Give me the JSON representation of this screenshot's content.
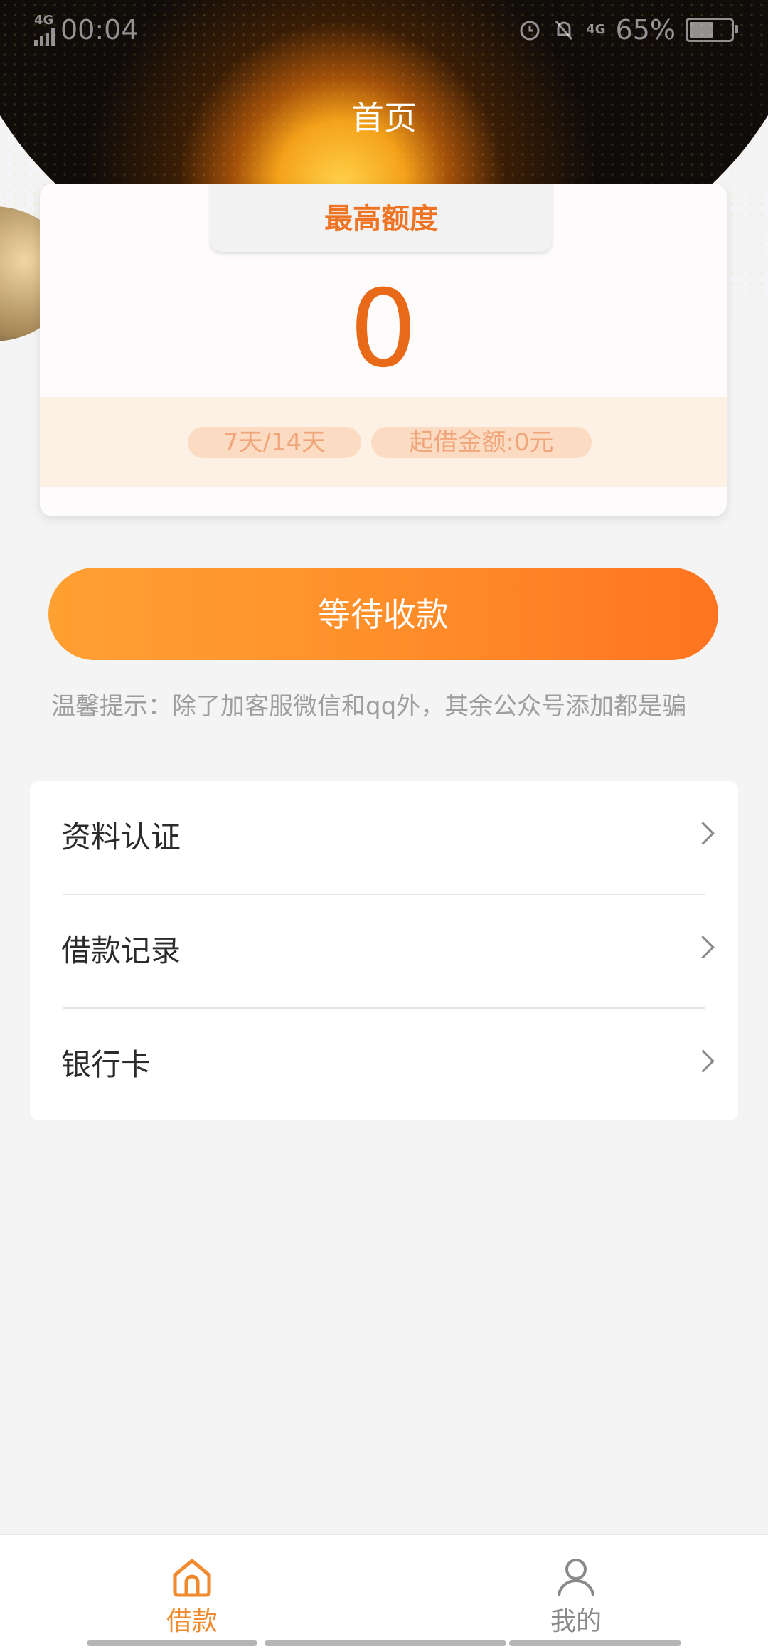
{
  "status_bar": {
    "network": "4G",
    "time": "00:04",
    "network_right": "4G",
    "battery": "65%",
    "battery_level": 0.65
  },
  "header": {
    "title": "首页"
  },
  "quota_card": {
    "tab_label": "最高额度",
    "amount": "0",
    "term": "7天/14天",
    "min_amount": "起借金额:0元"
  },
  "action_button": {
    "label": "等待收款"
  },
  "tip": {
    "text": "温馨提示：除了加客服微信和qq外，其余公众号添加都是骗"
  },
  "menu": {
    "items": [
      {
        "label": "资料认证"
      },
      {
        "label": "借款记录"
      },
      {
        "label": "银行卡"
      }
    ]
  },
  "bottom_nav": {
    "items": [
      {
        "label": "借款",
        "icon": "home-icon",
        "active": true
      },
      {
        "label": "我的",
        "icon": "user-icon",
        "active": false
      }
    ]
  },
  "colors": {
    "accent": "#ee7424",
    "button_start": "#ffa033",
    "button_end": "#ff7420",
    "pill_bg": "#fbdcc3",
    "page_bg": "#f4f4f4"
  }
}
